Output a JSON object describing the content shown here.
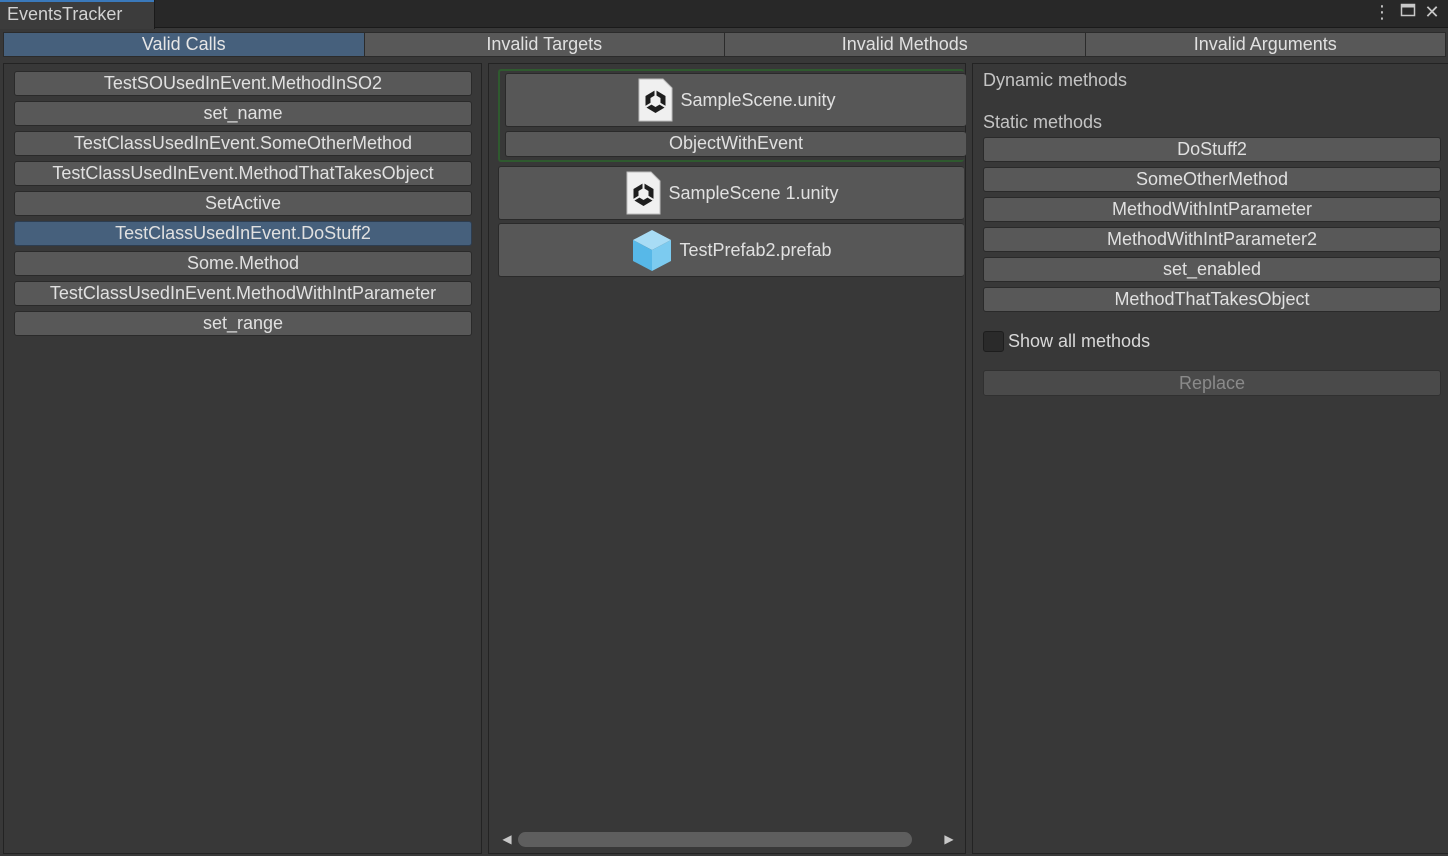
{
  "window": {
    "title": "EventsTracker"
  },
  "tabs": [
    {
      "label": "Valid Calls",
      "active": true
    },
    {
      "label": "Invalid Targets",
      "active": false
    },
    {
      "label": "Invalid Methods",
      "active": false
    },
    {
      "label": "Invalid Arguments",
      "active": false
    }
  ],
  "calls": [
    {
      "label": "TestSOUsedInEvent.MethodInSO2"
    },
    {
      "label": "set_name"
    },
    {
      "label": "TestClassUsedInEvent.SomeOtherMethod"
    },
    {
      "label": "TestClassUsedInEvent.MethodThatTakesObject"
    },
    {
      "label": "SetActive"
    },
    {
      "label": "TestClassUsedInEvent.DoStuff2",
      "selected": true
    },
    {
      "label": "Some.Method"
    },
    {
      "label": "TestClassUsedInEvent.MethodWithIntParameter"
    },
    {
      "label": "set_range"
    }
  ],
  "assets": {
    "scene1": {
      "label": "SampleScene.unity",
      "icon": "unity-scene-icon"
    },
    "scene1_object": {
      "label": "ObjectWithEvent"
    },
    "scene2": {
      "label": "SampleScene 1.unity",
      "icon": "unity-scene-icon"
    },
    "prefab": {
      "label": "TestPrefab2.prefab",
      "icon": "prefab-cube-icon"
    }
  },
  "methods": {
    "dynamic_label": "Dynamic methods",
    "static_label": "Static methods",
    "static": [
      {
        "label": "DoStuff2"
      },
      {
        "label": "SomeOtherMethod"
      },
      {
        "label": "MethodWithIntParameter"
      },
      {
        "label": "MethodWithIntParameter2"
      },
      {
        "label": "set_enabled"
      },
      {
        "label": "MethodThatTakesObject"
      }
    ],
    "show_all_label": "Show all methods",
    "show_all_checked": false,
    "replace_label": "Replace"
  },
  "colors": {
    "selection": "#46607c",
    "panel_bg": "#383838",
    "button_bg": "#585858",
    "group_border": "#2f5a2f"
  }
}
